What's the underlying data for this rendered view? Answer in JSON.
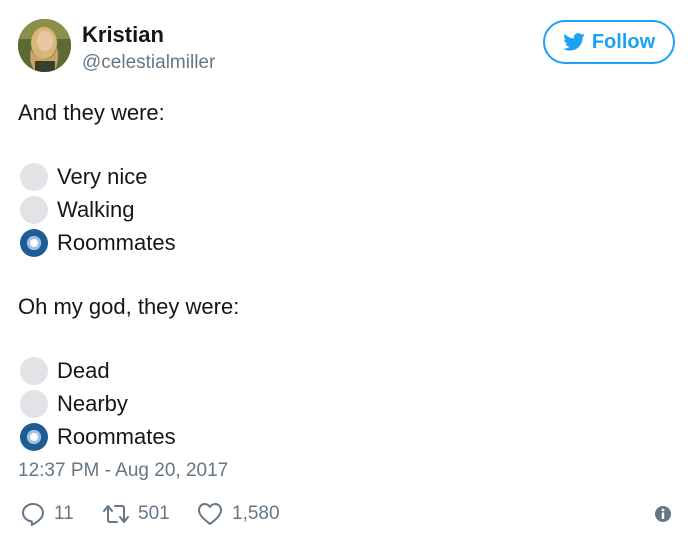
{
  "author": {
    "display_name": "Kristian",
    "handle": "@celestialmiller",
    "avatar_icon": "user-avatar-photo"
  },
  "follow_button": {
    "label": "Follow",
    "icon": "twitter-bird-icon",
    "color": "#1da1f2"
  },
  "tweet": {
    "stanza1": {
      "prompt": "And they were:",
      "options": [
        {
          "label": "Very nice",
          "selected": false
        },
        {
          "label": "Walking",
          "selected": false
        },
        {
          "label": "Roommates",
          "selected": true
        }
      ]
    },
    "stanza2": {
      "prompt": "Oh my god, they were:",
      "options": [
        {
          "label": "Dead",
          "selected": false
        },
        {
          "label": "Nearby",
          "selected": false
        },
        {
          "label": "Roommates",
          "selected": true
        }
      ]
    },
    "timestamp": "12:37 PM - Aug 20, 2017"
  },
  "actions": {
    "reply": {
      "icon": "reply-icon",
      "count": "11"
    },
    "retweet": {
      "icon": "retweet-icon",
      "count": "501"
    },
    "like": {
      "icon": "heart-icon",
      "count": "1,580"
    },
    "info": {
      "icon": "info-icon"
    }
  },
  "colors": {
    "text": "#14171a",
    "secondary_text": "#657786",
    "radio_unselected": "#e1e3e6",
    "radio_selected": "#1d5d93"
  }
}
